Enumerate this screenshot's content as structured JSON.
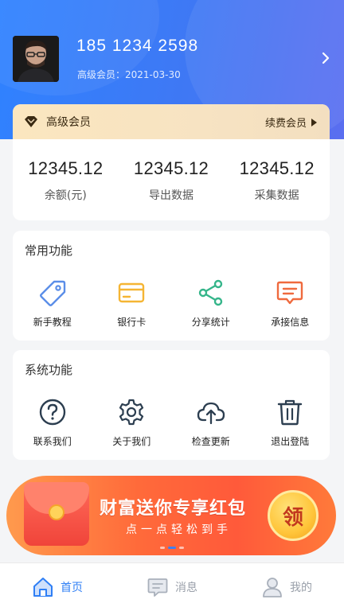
{
  "profile": {
    "phone": "185 1234 2598",
    "member_line": "高级会员：2021-03-30"
  },
  "vip": {
    "title": "高级会员",
    "renew_label": "续费会员"
  },
  "stats": [
    {
      "value": "12345.12",
      "label": "余额(元)"
    },
    {
      "value": "12345.12",
      "label": "导出数据"
    },
    {
      "value": "12345.12",
      "label": "采集数据"
    }
  ],
  "common": {
    "title": "常用功能",
    "items": [
      {
        "label": "新手教程",
        "icon": "tag-icon"
      },
      {
        "label": "银行卡",
        "icon": "bank-card-icon"
      },
      {
        "label": "分享统计",
        "icon": "share-icon"
      },
      {
        "label": "承接信息",
        "icon": "message-icon"
      }
    ]
  },
  "system": {
    "title": "系统功能",
    "items": [
      {
        "label": "联系我们",
        "icon": "question-icon"
      },
      {
        "label": "关于我们",
        "icon": "gear-icon"
      },
      {
        "label": "检查更新",
        "icon": "cloud-upload-icon"
      },
      {
        "label": "退出登陆",
        "icon": "trash-icon"
      }
    ]
  },
  "banner": {
    "title": "财富送你专享红包",
    "subtitle": "点一点轻松到手",
    "claim": "领"
  },
  "tabs": [
    {
      "label": "首页",
      "active": true
    },
    {
      "label": "消息",
      "active": false
    },
    {
      "label": "我的",
      "active": false
    }
  ],
  "colors": {
    "primary": "#2f7ff5",
    "vip_gold": "#fbe6bf",
    "banner_red": "#ff5a3a"
  }
}
